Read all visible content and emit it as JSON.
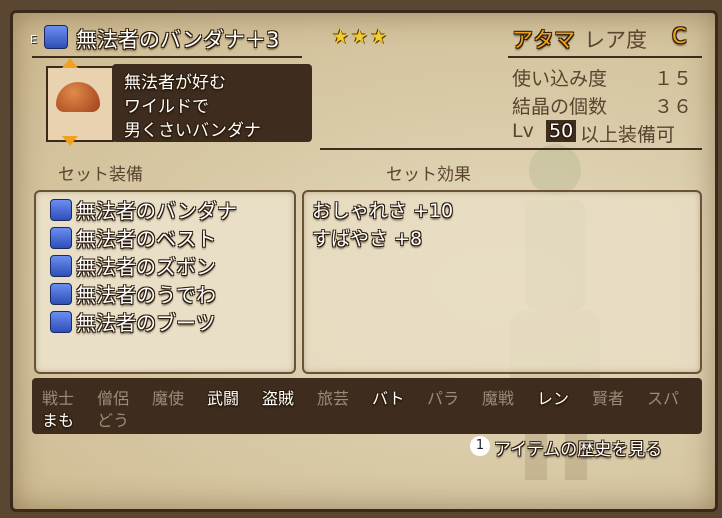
{
  "item": {
    "equipped_mark": "E",
    "name": "無法者のバンダナ＋3",
    "stars": "★★★",
    "slot": "アタマ",
    "rarity_label": "レア度",
    "rarity": "C",
    "description": [
      "無法者が好む",
      "ワイルドで",
      "男くさいバンダナ"
    ]
  },
  "stats": {
    "usage_label": "使い込み度",
    "usage": "１５",
    "crystal_label": "結晶の個数",
    "crystal": "３６",
    "lv_label": "Lv",
    "lv": "50",
    "lv_suffix": "以上装備可"
  },
  "set": {
    "equip_header": "セット装備",
    "effect_header": "セット効果",
    "items": [
      "無法者のバンダナ",
      "無法者のベスト",
      "無法者のズボン",
      "無法者のうでわ",
      "無法者のブーツ"
    ],
    "effects": [
      "おしゃれさ +10",
      "すばやさ +8"
    ]
  },
  "jobs": {
    "row1": [
      {
        "name": "戦士",
        "active": false
      },
      {
        "name": "僧侶",
        "active": false
      },
      {
        "name": "魔使",
        "active": false
      },
      {
        "name": "武闘",
        "active": true
      },
      {
        "name": "盗賊",
        "active": true
      },
      {
        "name": "旅芸",
        "active": false
      },
      {
        "name": "バト",
        "active": true
      },
      {
        "name": "パラ",
        "active": false
      },
      {
        "name": "魔戦",
        "active": false
      },
      {
        "name": "レン",
        "active": true
      },
      {
        "name": "賢者",
        "active": false
      },
      {
        "name": "スパ",
        "active": false
      }
    ],
    "row2": [
      {
        "name": "まも",
        "active": true
      },
      {
        "name": "どう",
        "active": false
      }
    ]
  },
  "footer": {
    "button_icon": "1",
    "history_label": "アイテムの歴史を見る"
  },
  "colors": {
    "accent": "#f0a21e",
    "parchment": "#d9cba8",
    "dark_panel": "#3e2d1f"
  }
}
